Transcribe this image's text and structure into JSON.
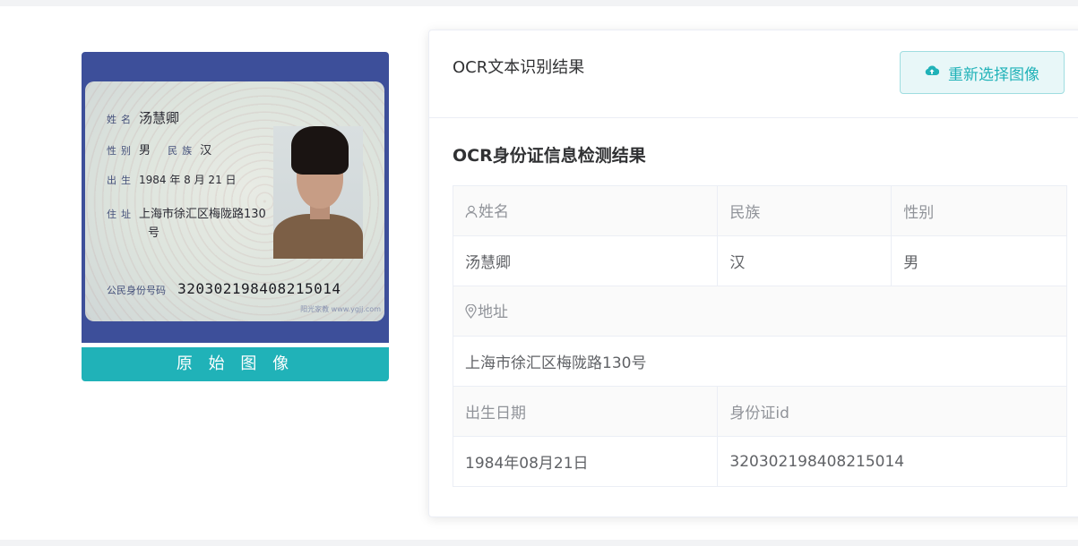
{
  "original_image": {
    "card": {
      "name_label": "姓名",
      "name_value": "汤慧卿",
      "gender_label": "性别",
      "gender_value": "男",
      "ethnicity_label": "民族",
      "ethnicity_value": "汉",
      "birth_label": "出生",
      "birth_value": "1984 年 8 月 21 日",
      "address_label": "住址",
      "address_line1": "上海市徐汇区梅陇路130",
      "address_line2": "号",
      "id_label": "公民身份号码",
      "id_value": "320302198408215014",
      "credit": "阳光家教 www.ygjj.com"
    },
    "caption": "原 始 图 像"
  },
  "panel": {
    "title": "OCR文本识别结果",
    "reselect_button": "重新选择图像",
    "reselect_icon": "cloud-upload-icon",
    "section_title": "OCR身份证信息检测结果"
  },
  "result": {
    "name_header": "姓名",
    "name_icon": "user-icon",
    "ethnicity_header": "民族",
    "gender_header": "性别",
    "name": "汤慧卿",
    "ethnicity": "汉",
    "gender": "男",
    "address_header": "地址",
    "address_icon": "location-icon",
    "address": "上海市徐汇区梅陇路130号",
    "birth_header": "出生日期",
    "id_header": "身份证id",
    "birth": "1984年08月21日",
    "id": "320302198408215014"
  },
  "colors": {
    "accent": "#20b2b8",
    "button_bg": "#e8f7f8",
    "label_text": "#909399",
    "value_text": "#606266"
  }
}
